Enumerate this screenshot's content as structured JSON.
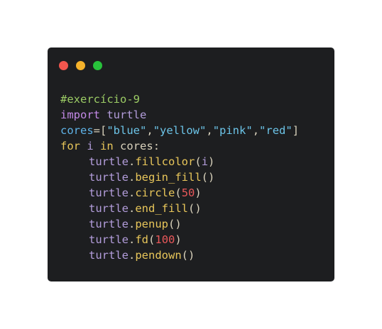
{
  "window": {
    "buttons": [
      {
        "name": "close",
        "color": "#f2564e"
      },
      {
        "name": "minimize",
        "color": "#f5b22b"
      },
      {
        "name": "maximize",
        "color": "#28c23b"
      }
    ]
  },
  "code": {
    "comment": "#exercício-9",
    "import_kw": "import",
    "module": "turtle",
    "var_name": "cores",
    "assign": "=[",
    "colors": [
      "\"blue\"",
      "\"yellow\"",
      "\"pink\"",
      "\"red\""
    ],
    "comma": ",",
    "close_bracket": "]",
    "for_kw": "for",
    "loop_var": "i",
    "in_kw": "in",
    "iterable": "cores:",
    "obj": "turtle",
    "dot": ".",
    "calls": [
      {
        "func": "fillcolor",
        "open": "(",
        "arg": "i",
        "arg_type": "ident",
        "close": ")"
      },
      {
        "func": "begin_fill",
        "open": "(",
        "arg": "",
        "arg_type": "none",
        "close": ")"
      },
      {
        "func": "circle",
        "open": "(",
        "arg": "50",
        "arg_type": "num",
        "close": ")"
      },
      {
        "func": "end_fill",
        "open": "(",
        "arg": "",
        "arg_type": "none",
        "close": ")"
      },
      {
        "func": "penup",
        "open": "(",
        "arg": "",
        "arg_type": "none",
        "close": ")"
      },
      {
        "func": "fd",
        "open": "(",
        "arg": "100",
        "arg_type": "num",
        "close": ")"
      },
      {
        "func": "pendown",
        "open": "(",
        "arg": "",
        "arg_type": "none",
        "close": ")"
      }
    ]
  }
}
